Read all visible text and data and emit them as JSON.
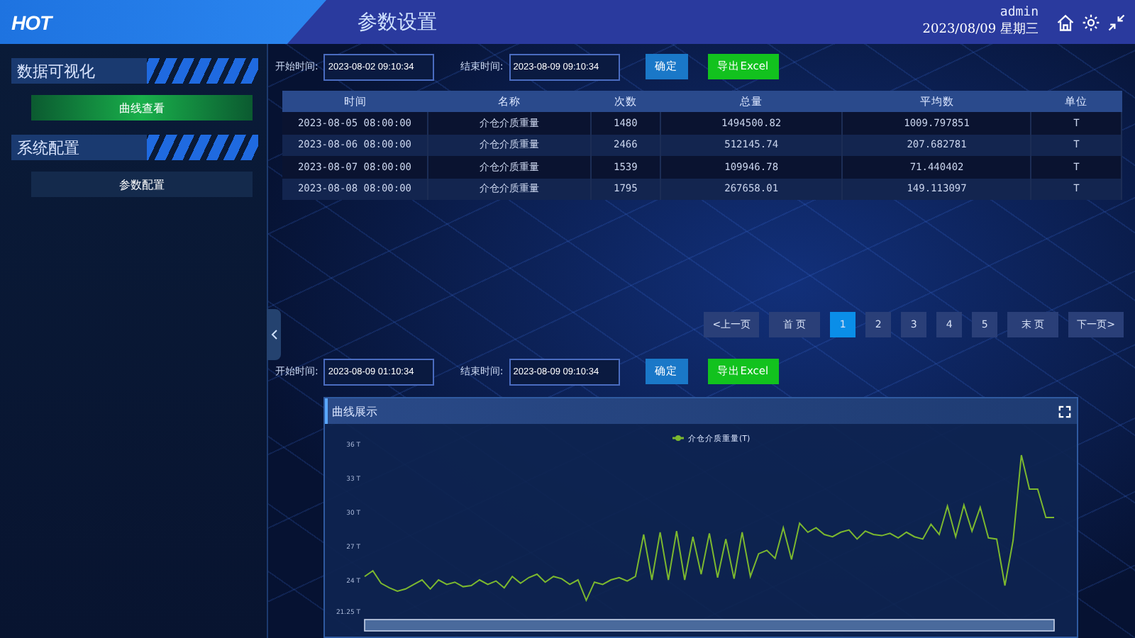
{
  "header": {
    "logo": "HOT",
    "title": "参数设置",
    "user": "admin",
    "date": "2023/08/09 星期三"
  },
  "sidebar": {
    "sections": [
      {
        "title": "数据可视化",
        "items": [
          {
            "label": "曲线查看",
            "selected": true
          }
        ]
      },
      {
        "title": "系统配置",
        "items": [
          {
            "label": "参数配置",
            "selected": false
          }
        ]
      }
    ]
  },
  "top_filter": {
    "start_label": "开始时间:",
    "start_value": "2023-08-02 09:10:34",
    "end_label": "结束时间:",
    "end_value": "2023-08-09 09:10:34",
    "confirm": "确定",
    "export": "导出Excel"
  },
  "table": {
    "columns": [
      "时间",
      "名称",
      "次数",
      "总量",
      "平均数",
      "单位"
    ],
    "rows": [
      [
        "2023-08-05 08:00:00",
        "介仓介质重量",
        "1480",
        "1494500.82",
        "1009.797851",
        "T"
      ],
      [
        "2023-08-06 08:00:00",
        "介仓介质重量",
        "2466",
        "512145.74",
        "207.682781",
        "T"
      ],
      [
        "2023-08-07 08:00:00",
        "介仓介质重量",
        "1539",
        "109946.78",
        "71.440402",
        "T"
      ],
      [
        "2023-08-08 08:00:00",
        "介仓介质重量",
        "1795",
        "267658.01",
        "149.113097",
        "T"
      ]
    ]
  },
  "pagination": [
    {
      "label": "<上一页",
      "kind": "nav",
      "selected": false
    },
    {
      "label": "首 页",
      "kind": "nav",
      "selected": false
    },
    {
      "label": "1",
      "kind": "page",
      "selected": true
    },
    {
      "label": "2",
      "kind": "page",
      "selected": false
    },
    {
      "label": "3",
      "kind": "page",
      "selected": false
    },
    {
      "label": "4",
      "kind": "page",
      "selected": false
    },
    {
      "label": "5",
      "kind": "page",
      "selected": false
    },
    {
      "label": "末 页",
      "kind": "nav",
      "selected": false
    },
    {
      "label": "下一页>",
      "kind": "nav",
      "selected": false
    }
  ],
  "chart_filter": {
    "start_label": "开始时间:",
    "start_value": "2023-08-09 01:10:34",
    "end_label": "结束时间:",
    "end_value": "2023-08-09 09:10:34",
    "confirm": "确定",
    "export": "导出Excel"
  },
  "chart_panel": {
    "title": "曲线展示",
    "chart_data": {
      "type": "line",
      "ylim": [
        21.25,
        36
      ],
      "yticks": [
        {
          "value": 21.25,
          "label": "21.25 T"
        },
        {
          "value": 24,
          "label": "24 T"
        },
        {
          "value": 27,
          "label": "27 T"
        },
        {
          "value": 30,
          "label": "30 T"
        },
        {
          "value": 33,
          "label": "33 T"
        },
        {
          "value": 36,
          "label": "36 T"
        }
      ],
      "series": [
        {
          "name": "介仓介质重量(T)",
          "color": "#7cb82f",
          "values": [
            24.3,
            24.8,
            23.7,
            23.3,
            23.0,
            23.2,
            23.6,
            24.0,
            23.2,
            24.0,
            23.6,
            23.8,
            23.4,
            23.5,
            24.0,
            23.6,
            23.9,
            23.3,
            24.3,
            23.7,
            24.2,
            24.5,
            23.8,
            24.3,
            24.1,
            23.6,
            24.0,
            22.2,
            23.8,
            23.6,
            24.0,
            24.2,
            23.9,
            24.3,
            28.0,
            24.0,
            28.2,
            24.0,
            28.3,
            24.0,
            27.8,
            24.5,
            28.1,
            24.2,
            27.6,
            24.1,
            28.2,
            24.3,
            26.3,
            26.6,
            25.9,
            28.6,
            25.8,
            29.0,
            28.2,
            28.6,
            28.0,
            27.8,
            28.2,
            28.4,
            27.6,
            28.3,
            28.0,
            27.9,
            28.1,
            27.7,
            28.2,
            27.8,
            27.6,
            28.9,
            28.0,
            30.5,
            27.8,
            30.6,
            28.3,
            30.4,
            27.7,
            27.6,
            23.5,
            27.5,
            35.0,
            32.0,
            32.0,
            29.5,
            29.5
          ]
        }
      ]
    }
  }
}
